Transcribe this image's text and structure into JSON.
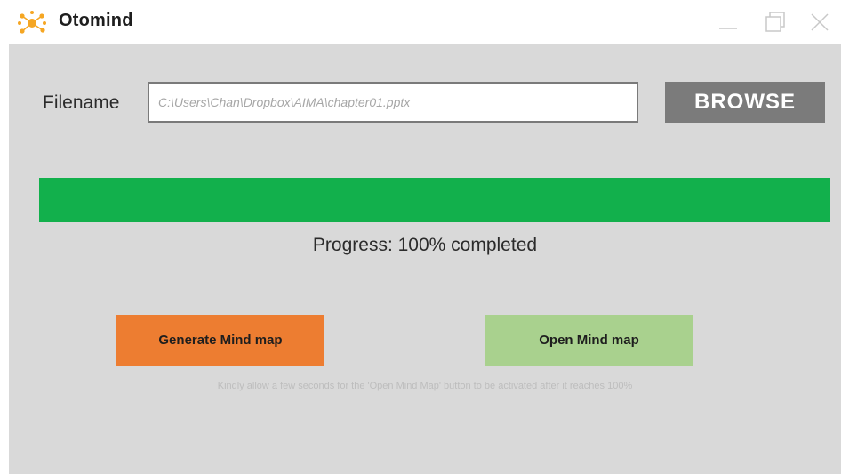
{
  "window": {
    "title": "Otomind",
    "logo_icon": "sun-burst-logo",
    "controls": {
      "minimize_icon": "minimize-icon",
      "restore_icon": "restore-icon",
      "close_icon": "close-icon"
    }
  },
  "form": {
    "filename_label": "Filename",
    "filename_value": "C:\\Users\\Chan\\Dropbox\\AIMA\\chapter01.pptx",
    "browse_label": "BROWSE"
  },
  "progress": {
    "percent": 100,
    "text": "Progress: 100% completed",
    "fill_color": "#12b04c"
  },
  "actions": {
    "generate_label": "Generate Mind map",
    "generate_color": "#ed7d31",
    "open_label": "Open Mind map",
    "open_color": "#a9d18e"
  },
  "hint": "Kindly allow a few seconds for the 'Open Mind Map' button to be activated after it reaches 100%"
}
